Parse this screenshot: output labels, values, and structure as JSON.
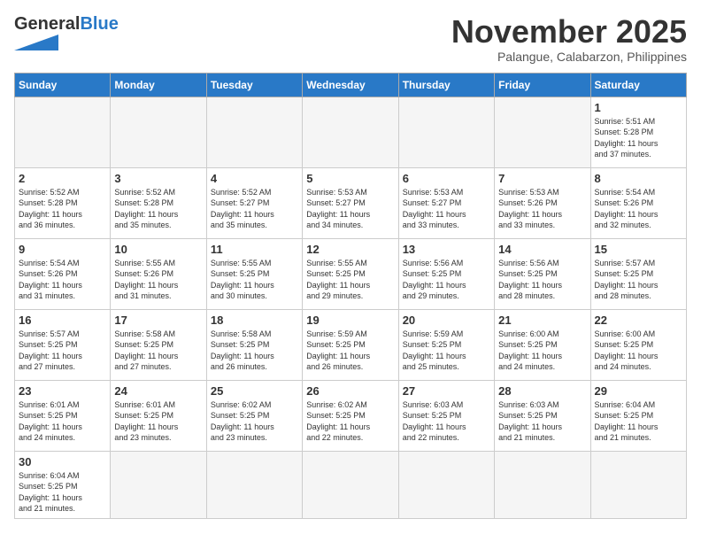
{
  "header": {
    "logo_general": "General",
    "logo_blue": "Blue",
    "month_title": "November 2025",
    "location": "Palangue, Calabarzon, Philippines"
  },
  "weekdays": [
    "Sunday",
    "Monday",
    "Tuesday",
    "Wednesday",
    "Thursday",
    "Friday",
    "Saturday"
  ],
  "weeks": [
    [
      {
        "day": "",
        "info": ""
      },
      {
        "day": "",
        "info": ""
      },
      {
        "day": "",
        "info": ""
      },
      {
        "day": "",
        "info": ""
      },
      {
        "day": "",
        "info": ""
      },
      {
        "day": "",
        "info": ""
      },
      {
        "day": "1",
        "info": "Sunrise: 5:51 AM\nSunset: 5:28 PM\nDaylight: 11 hours\nand 37 minutes."
      }
    ],
    [
      {
        "day": "2",
        "info": "Sunrise: 5:52 AM\nSunset: 5:28 PM\nDaylight: 11 hours\nand 36 minutes."
      },
      {
        "day": "3",
        "info": "Sunrise: 5:52 AM\nSunset: 5:28 PM\nDaylight: 11 hours\nand 35 minutes."
      },
      {
        "day": "4",
        "info": "Sunrise: 5:52 AM\nSunset: 5:27 PM\nDaylight: 11 hours\nand 35 minutes."
      },
      {
        "day": "5",
        "info": "Sunrise: 5:53 AM\nSunset: 5:27 PM\nDaylight: 11 hours\nand 34 minutes."
      },
      {
        "day": "6",
        "info": "Sunrise: 5:53 AM\nSunset: 5:27 PM\nDaylight: 11 hours\nand 33 minutes."
      },
      {
        "day": "7",
        "info": "Sunrise: 5:53 AM\nSunset: 5:26 PM\nDaylight: 11 hours\nand 33 minutes."
      },
      {
        "day": "8",
        "info": "Sunrise: 5:54 AM\nSunset: 5:26 PM\nDaylight: 11 hours\nand 32 minutes."
      }
    ],
    [
      {
        "day": "9",
        "info": "Sunrise: 5:54 AM\nSunset: 5:26 PM\nDaylight: 11 hours\nand 31 minutes."
      },
      {
        "day": "10",
        "info": "Sunrise: 5:55 AM\nSunset: 5:26 PM\nDaylight: 11 hours\nand 31 minutes."
      },
      {
        "day": "11",
        "info": "Sunrise: 5:55 AM\nSunset: 5:25 PM\nDaylight: 11 hours\nand 30 minutes."
      },
      {
        "day": "12",
        "info": "Sunrise: 5:55 AM\nSunset: 5:25 PM\nDaylight: 11 hours\nand 29 minutes."
      },
      {
        "day": "13",
        "info": "Sunrise: 5:56 AM\nSunset: 5:25 PM\nDaylight: 11 hours\nand 29 minutes."
      },
      {
        "day": "14",
        "info": "Sunrise: 5:56 AM\nSunset: 5:25 PM\nDaylight: 11 hours\nand 28 minutes."
      },
      {
        "day": "15",
        "info": "Sunrise: 5:57 AM\nSunset: 5:25 PM\nDaylight: 11 hours\nand 28 minutes."
      }
    ],
    [
      {
        "day": "16",
        "info": "Sunrise: 5:57 AM\nSunset: 5:25 PM\nDaylight: 11 hours\nand 27 minutes."
      },
      {
        "day": "17",
        "info": "Sunrise: 5:58 AM\nSunset: 5:25 PM\nDaylight: 11 hours\nand 27 minutes."
      },
      {
        "day": "18",
        "info": "Sunrise: 5:58 AM\nSunset: 5:25 PM\nDaylight: 11 hours\nand 26 minutes."
      },
      {
        "day": "19",
        "info": "Sunrise: 5:59 AM\nSunset: 5:25 PM\nDaylight: 11 hours\nand 26 minutes."
      },
      {
        "day": "20",
        "info": "Sunrise: 5:59 AM\nSunset: 5:25 PM\nDaylight: 11 hours\nand 25 minutes."
      },
      {
        "day": "21",
        "info": "Sunrise: 6:00 AM\nSunset: 5:25 PM\nDaylight: 11 hours\nand 24 minutes."
      },
      {
        "day": "22",
        "info": "Sunrise: 6:00 AM\nSunset: 5:25 PM\nDaylight: 11 hours\nand 24 minutes."
      }
    ],
    [
      {
        "day": "23",
        "info": "Sunrise: 6:01 AM\nSunset: 5:25 PM\nDaylight: 11 hours\nand 24 minutes."
      },
      {
        "day": "24",
        "info": "Sunrise: 6:01 AM\nSunset: 5:25 PM\nDaylight: 11 hours\nand 23 minutes."
      },
      {
        "day": "25",
        "info": "Sunrise: 6:02 AM\nSunset: 5:25 PM\nDaylight: 11 hours\nand 23 minutes."
      },
      {
        "day": "26",
        "info": "Sunrise: 6:02 AM\nSunset: 5:25 PM\nDaylight: 11 hours\nand 22 minutes."
      },
      {
        "day": "27",
        "info": "Sunrise: 6:03 AM\nSunset: 5:25 PM\nDaylight: 11 hours\nand 22 minutes."
      },
      {
        "day": "28",
        "info": "Sunrise: 6:03 AM\nSunset: 5:25 PM\nDaylight: 11 hours\nand 21 minutes."
      },
      {
        "day": "29",
        "info": "Sunrise: 6:04 AM\nSunset: 5:25 PM\nDaylight: 11 hours\nand 21 minutes."
      }
    ],
    [
      {
        "day": "30",
        "info": "Sunrise: 6:04 AM\nSunset: 5:25 PM\nDaylight: 11 hours\nand 21 minutes."
      },
      {
        "day": "",
        "info": ""
      },
      {
        "day": "",
        "info": ""
      },
      {
        "day": "",
        "info": ""
      },
      {
        "day": "",
        "info": ""
      },
      {
        "day": "",
        "info": ""
      },
      {
        "day": "",
        "info": ""
      }
    ]
  ]
}
